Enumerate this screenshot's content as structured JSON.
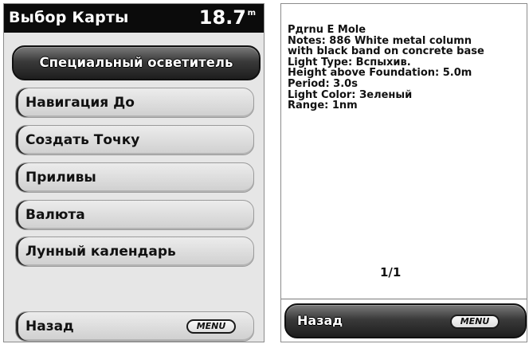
{
  "left": {
    "title": "Выбор Карты",
    "depth": "18.7",
    "depth_unit": "m",
    "menu_items": [
      "Специальный осветитель",
      "Навигация До",
      "Создать Точку",
      "Приливы",
      "Валюта",
      "Лунный календарь"
    ],
    "back_label": "Назад",
    "menu_pill": "MENU"
  },
  "right": {
    "info_lines": [
      "Pдrnu E Mole",
      "Notes: 886 White metal column",
      "with black band on concrete base",
      "Light Type: Вспыхив.",
      "Height above Foundation: 5.0m",
      "Period: 3.0s",
      "Light Color: Зеленый",
      "Range: 1nm"
    ],
    "page_indicator": "1/1",
    "back_label": "Назад",
    "menu_pill": "MENU"
  }
}
